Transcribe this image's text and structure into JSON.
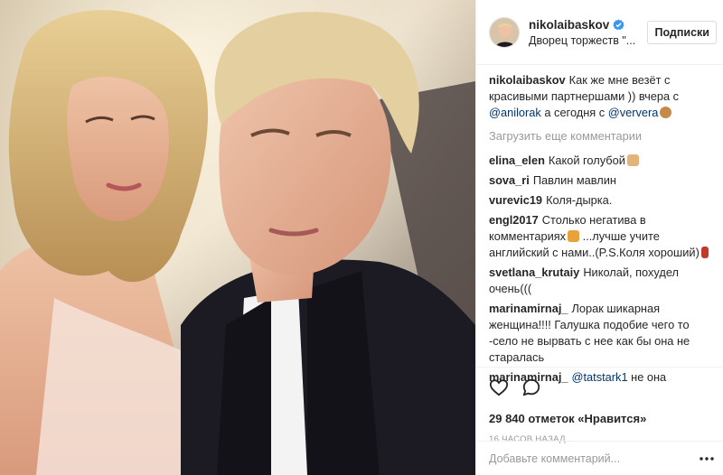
{
  "post": {
    "author": {
      "username": "nikolaibaskov",
      "location": "Дворец торжеств \"...",
      "verified": true
    },
    "follow_label": "Подписки",
    "caption": {
      "username": "nikolaibaskov",
      "text_1": "Как же мне везёт с красивыми партнершами )) вчера с ",
      "mention_1": "@anilorak",
      "text_2": " а сегодня с ",
      "mention_2": "@ververa"
    },
    "load_more_label": "Загрузить еще комментарии",
    "comments": [
      {
        "username": "elina_elen",
        "text": "Какой голубой"
      },
      {
        "username": "sova_ri",
        "text": "Павлин мавлин"
      },
      {
        "username": "vurevic19",
        "text": "Коля-дырка."
      },
      {
        "username": "engl2017",
        "text_1": "Столько негатива в комментариях",
        "text_2": " ...лучше учите английский с нами..(P.S.Коля хороший)"
      },
      {
        "username": "svetlana_krutaiy",
        "text": "Николай, похудел очень((("
      },
      {
        "username": "marinamirnaj_",
        "text": "Лорак шикарная женщина!!!! Галушка подобие чего то -село не вырвать с нее как бы она не старалась"
      },
      {
        "username": "marinamirnaj_",
        "mention": "@tatstark1",
        "text": " не она"
      }
    ],
    "likes_label": "29 840 отметок «Нравится»",
    "time_label": "16 ЧАСОВ НАЗАД",
    "add_comment_placeholder": "Добавьте комментарий...",
    "icons": {
      "like": "heart-icon",
      "comment": "comment-icon",
      "more": "more-dots-icon",
      "verified": "verified-badge-icon"
    },
    "colors": {
      "accent": "#3897f0",
      "mention": "#003569",
      "muted": "#999999"
    }
  }
}
